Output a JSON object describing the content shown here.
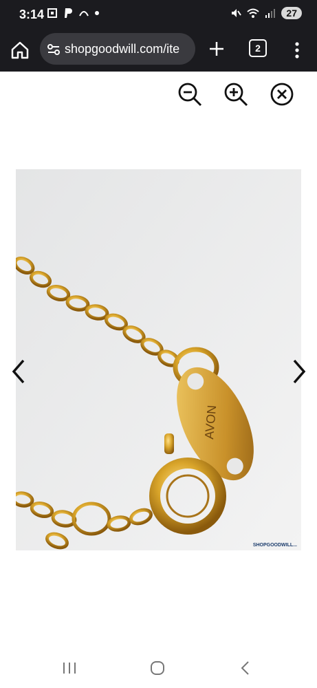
{
  "status": {
    "time": "3:14",
    "battery": "27"
  },
  "browser": {
    "url": "shopgoodwill.com/ite",
    "tab_count": "2"
  },
  "viewer": {
    "image_engraving": "AVON",
    "watermark": "SHOPGOODWILL..."
  },
  "colors": {
    "chrome": "#1b1b1f",
    "url_pill": "#3a3a3f",
    "gold": "#d9a52a"
  }
}
